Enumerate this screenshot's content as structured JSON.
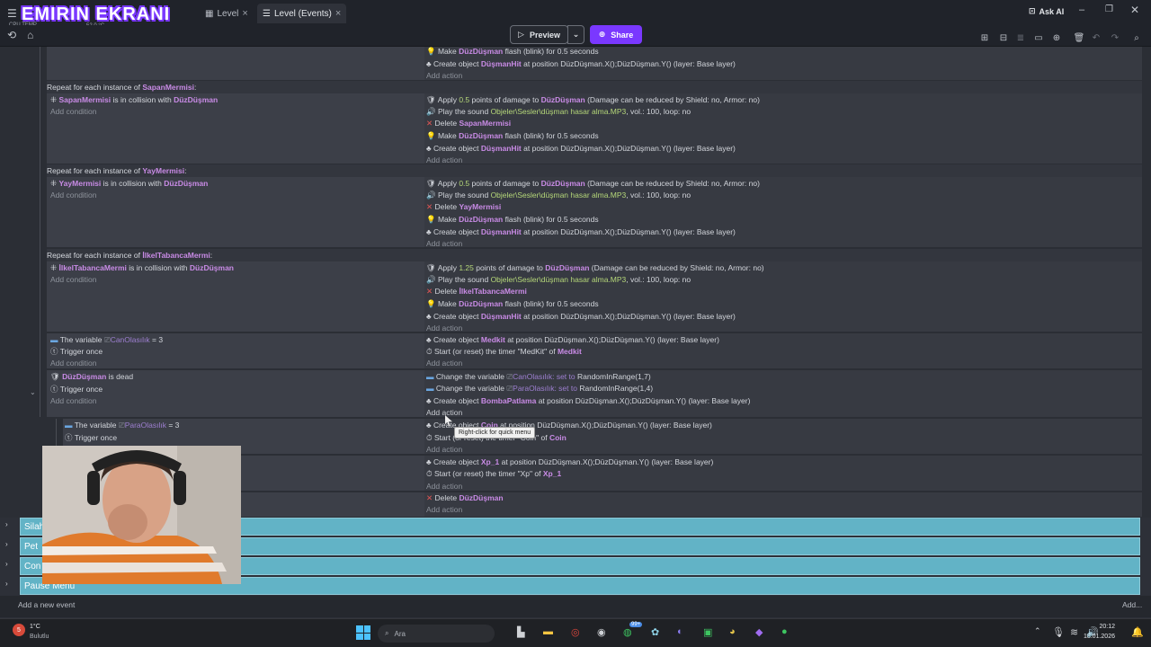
{
  "header": {
    "brand": "EMIRIN EKRANI",
    "cpu_label": "CPU TEMP",
    "cpu_value": "52.0 °C",
    "tabs": [
      {
        "label": "Level"
      },
      {
        "label": "Level (Events)"
      }
    ],
    "ask_ai": "Ask AI"
  },
  "toolbar": {
    "preview": "Preview",
    "share": "Share"
  },
  "events": {
    "top_actions": [
      {
        "verb": "Make",
        "obj": "DüzDüşman",
        "rest": "flash (blink) for 0.5 seconds"
      },
      {
        "verb": "Create object",
        "obj": "DüşmanHit",
        "rest": "at position DüzDüşman.X();DüzDüşman.Y() (layer: Base layer)"
      }
    ],
    "add_action": "Add action",
    "add_condition": "Add condition",
    "repeat_blocks": [
      {
        "header_prefix": "Repeat for each instance of",
        "header_obj": "SapanMermisi",
        "header_suffix": ":",
        "cond_obj": "SapanMermisi",
        "cond_mid": "is in collision with",
        "cond_target": "DüzDüşman",
        "damage_prefix": "Apply",
        "damage_val": "0.5",
        "damage_mid": "points of damage to",
        "damage_obj": "DüzDüşman",
        "damage_rest": "(Damage can be reduced by Shield: no, Armor: no)",
        "sound_prefix": "Play the sound",
        "sound_file": "Objeler\\Sesler\\düşman hasar alma.MP3",
        "sound_rest": ", vol.: 100, loop: no",
        "delete_label": "Delete",
        "delete_obj": "SapanMermisi",
        "flash_verb": "Make",
        "flash_obj": "DüzDüşman",
        "flash_rest": "flash (blink) for 0.5 seconds",
        "create_verb": "Create object",
        "create_obj": "DüşmanHit",
        "create_rest": "at position DüzDüşman.X();DüzDüşman.Y() (layer: Base layer)"
      },
      {
        "header_prefix": "Repeat for each instance of",
        "header_obj": "YayMermisi",
        "header_suffix": ":",
        "cond_obj": "YayMermisi",
        "cond_mid": "is in collision with",
        "cond_target": "DüzDüşman",
        "damage_prefix": "Apply",
        "damage_val": "0.5",
        "damage_mid": "points of damage to",
        "damage_obj": "DüzDüşman",
        "damage_rest": "(Damage can be reduced by Shield: no, Armor: no)",
        "sound_prefix": "Play the sound",
        "sound_file": "Objeler\\Sesler\\düşman hasar alma.MP3",
        "sound_rest": ", vol.: 100, loop: no",
        "delete_label": "Delete",
        "delete_obj": "YayMermisi",
        "flash_verb": "Make",
        "flash_obj": "DüzDüşman",
        "flash_rest": "flash (blink) for 0.5 seconds",
        "create_verb": "Create object",
        "create_obj": "DüşmanHit",
        "create_rest": "at position DüzDüşman.X();DüzDüşman.Y() (layer: Base layer)"
      },
      {
        "header_prefix": "Repeat for each instance of",
        "header_obj": "İlkelTabancaMermi",
        "header_suffix": ":",
        "cond_obj": "İlkelTabancaMermi",
        "cond_mid": "is in collision with",
        "cond_target": "DüzDüşman",
        "damage_prefix": "Apply",
        "damage_val": "1.25",
        "damage_mid": "points of damage to",
        "damage_obj": "DüzDüşman",
        "damage_rest": "(Damage can be reduced by Shield: no, Armor: no)",
        "sound_prefix": "Play the sound",
        "sound_file": "Objeler\\Sesler\\düşman hasar alma.MP3",
        "sound_rest": ", vol.: 100, loop: no",
        "delete_label": "Delete",
        "delete_obj": "İlkelTabancaMermi",
        "flash_verb": "Make",
        "flash_obj": "DüzDüşman",
        "flash_rest": "flash (blink) for 0.5 seconds",
        "create_verb": "Create object",
        "create_obj": "DüşmanHit",
        "create_rest": "at position DüzDüşman.X();DüzDüşman.Y() (layer: Base layer)"
      }
    ],
    "medkit": {
      "cond_prefix": "The variable",
      "cond_var": "CanOlasılık",
      "cond_rest": "= 3",
      "trigger": "Trigger once",
      "create_verb": "Create object",
      "create_obj": "Medkit",
      "create_rest": "at position DüzDüşman.X();DüzDüşman.Y() (layer: Base layer)",
      "timer_prefix": "Start (or reset) the timer",
      "timer_name": "\"MedKit\"",
      "timer_of": "of",
      "timer_obj": "Medkit"
    },
    "dead": {
      "cond_obj": "DüzDüşman",
      "cond_rest": "is dead",
      "trigger": "Trigger once",
      "change1_prefix": "Change the variable",
      "change1_var": "CanOlasılık",
      "change1_set": ": set to",
      "change1_val": "RandomInRange(1,7)",
      "change2_prefix": "Change the variable",
      "change2_var": "ParaOlasılık",
      "change2_set": ": set to",
      "change2_val": "RandomInRange(1,4)",
      "create_verb": "Create object",
      "create_obj": "BombaPatlama",
      "create_rest": "at position DüzDüşman.X();DüzDüşman.Y() (layer: Base layer)"
    },
    "tooltip": "Right-click for quick menu",
    "coin": {
      "cond_prefix": "The variable",
      "cond_var": "ParaOlasılık",
      "cond_rest": "= 3",
      "trigger": "Trigger once",
      "create_verb": "Create object",
      "create_obj": "Coin",
      "create_rest": "at position DüzDüşman.X();DüzDüşman.Y() (layer: Base layer)",
      "timer_prefix": "Start (or reset) the timer",
      "timer_name": "\"Coin\"",
      "timer_of": "of",
      "timer_obj": "Coin"
    },
    "xp": {
      "create_verb": "Create object",
      "create_obj": "Xp_1",
      "create_rest": "at position DüzDüşman.X();DüzDüşman.Y() (layer: Base layer)",
      "timer_prefix": "Start (or reset) the timer",
      "timer_name": "\"Xp\"",
      "timer_of": "of",
      "timer_obj": "Xp_1"
    },
    "delete_final": {
      "label": "Delete",
      "obj": "DüzDüşman"
    }
  },
  "groups": [
    {
      "name": "Silah"
    },
    {
      "name": "Pet"
    },
    {
      "name": "Con"
    },
    {
      "name": "Pause Menu"
    }
  ],
  "footer": {
    "add_event": "Add a new event",
    "add_right": "Add..."
  },
  "taskbar": {
    "weather_temp": "1°C",
    "weather_desc": "Bulutlu",
    "weather_badge": "5",
    "search": "Ara",
    "badge_99": "99+",
    "time": "20:12",
    "date": "18.01.2026"
  },
  "colors": {
    "object": "#c98be6",
    "param": "#b5d779",
    "group": "#62b3c6",
    "share": "#7a38ff"
  }
}
